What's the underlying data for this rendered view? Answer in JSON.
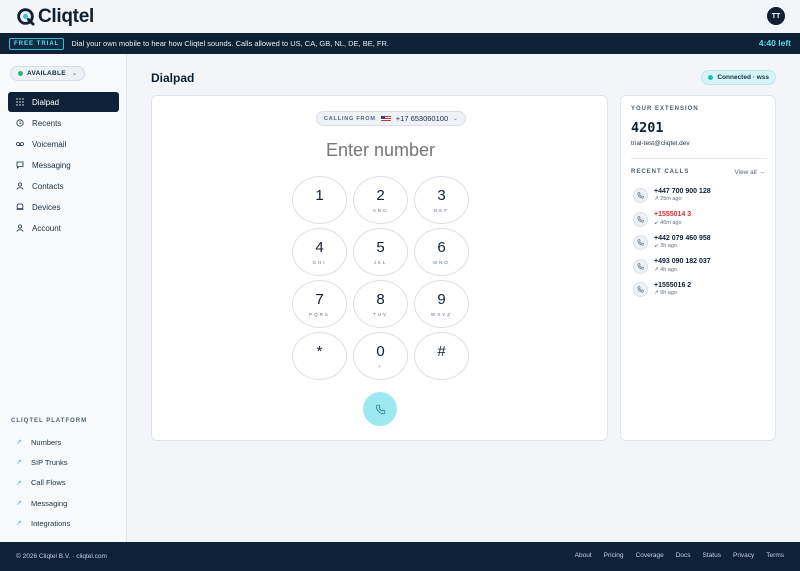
{
  "app": {
    "name": "Cliqtel",
    "user_initials": "TT"
  },
  "banner": {
    "badge": "FREE TRIAL",
    "message": "Dial your own mobile to hear how Cliqtel sounds. Calls allowed to US, CA, GB, NL, DE, BE, FR.",
    "time_left": "4:40 left"
  },
  "sidebar": {
    "status": "AVAILABLE",
    "items": [
      {
        "label": "Dialpad",
        "icon": "grid-icon",
        "active": true
      },
      {
        "label": "Recents",
        "icon": "history-icon"
      },
      {
        "label": "Voicemail",
        "icon": "voicemail-icon"
      },
      {
        "label": "Messaging",
        "icon": "chat-icon"
      },
      {
        "label": "Contacts",
        "icon": "user-icon"
      },
      {
        "label": "Devices",
        "icon": "device-icon"
      },
      {
        "label": "Account",
        "icon": "user-icon"
      }
    ],
    "platform_heading": "CLIQTEL PLATFORM",
    "platform_items": [
      "Numbers",
      "SIP Trunks",
      "Call Flows",
      "Messaging",
      "Integrations"
    ]
  },
  "main": {
    "title": "Dialpad",
    "connection": "Connected · wss",
    "calling_from_label": "CALLING FROM",
    "calling_from_number": "+17 653060100",
    "number_placeholder": "Enter number",
    "keys": [
      {
        "digit": "1",
        "letters": ""
      },
      {
        "digit": "2",
        "letters": "ABC"
      },
      {
        "digit": "3",
        "letters": "DEF"
      },
      {
        "digit": "4",
        "letters": "GHI"
      },
      {
        "digit": "5",
        "letters": "JKL"
      },
      {
        "digit": "6",
        "letters": "MNO"
      },
      {
        "digit": "7",
        "letters": "PQRS"
      },
      {
        "digit": "8",
        "letters": "TUV"
      },
      {
        "digit": "9",
        "letters": "WXYZ"
      },
      {
        "digit": "*",
        "letters": ""
      },
      {
        "digit": "0",
        "letters": "+"
      },
      {
        "digit": "#",
        "letters": ""
      }
    ]
  },
  "extension": {
    "heading": "YOUR EXTENSION",
    "number": "4201",
    "email": "trial-test@cliqtel.dev",
    "recent_heading": "RECENT CALLS",
    "view_all": "View all →",
    "calls": [
      {
        "number": "+447 700 900 128",
        "time": "↗ 25m ago",
        "missed": false
      },
      {
        "number": "+1555014 3",
        "time": "↙ 46m ago",
        "missed": true
      },
      {
        "number": "+442 079 460 958",
        "time": "↙ 3h ago",
        "missed": false
      },
      {
        "number": "+493 090 182 037",
        "time": "↗ 4h ago",
        "missed": false
      },
      {
        "number": "+1555016 2",
        "time": "↗ 9h ago",
        "missed": false
      }
    ]
  },
  "footer": {
    "copyright": "© 2026 Cliqtel B.V. · cliqtel.com",
    "links": [
      "About",
      "Pricing",
      "Coverage",
      "Docs",
      "Status",
      "Privacy",
      "Terms"
    ]
  },
  "colors": {
    "navy": "#0d2237",
    "accent": "#5ed7e9",
    "available": "#1fbf6a",
    "missed": "#dc2f3b"
  }
}
